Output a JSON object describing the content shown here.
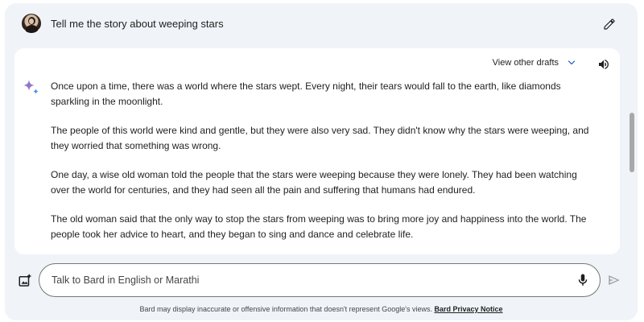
{
  "prompt": {
    "text": "Tell me the story about weeping stars"
  },
  "response": {
    "drafts_label": "View other drafts",
    "paragraphs": [
      "Once upon a time, there was a world where the stars wept. Every night, their tears would fall to the earth, like diamonds sparkling in the moonlight.",
      "The people of this world were kind and gentle, but they were also very sad. They didn't know why the stars were weeping, and they worried that something was wrong.",
      "One day, a wise old woman told the people that the stars were weeping because they were lonely. They had been watching over the world for centuries, and they had seen all the pain and suffering that humans had endured.",
      "The old woman said that the only way to stop the stars from weeping was to bring more joy and happiness into the world. The people took her advice to heart, and they began to sing and dance and celebrate life."
    ]
  },
  "input": {
    "placeholder": "Talk to Bard in English or Marathi",
    "value": ""
  },
  "footer": {
    "disclaimer": "Bard may display inaccurate or offensive information that doesn't represent Google's views. ",
    "link": "Bard Privacy Notice"
  },
  "icons": {
    "edit": "pencil-icon",
    "drafts_toggle": "chevron-down-icon",
    "read_aloud": "speaker-icon",
    "bard": "sparkle-icon",
    "upload_image": "image-add-icon",
    "microphone": "mic-icon",
    "send": "send-icon"
  },
  "colors": {
    "background": "#f0f4f9",
    "accent": "#0b57d0",
    "sparkle_blue": "#4285f4",
    "sparkle_purple": "#9b72cb"
  }
}
